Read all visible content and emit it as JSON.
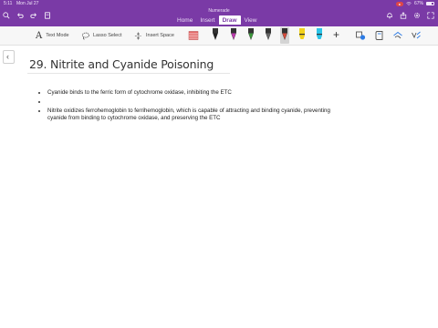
{
  "status_bar": {
    "time": "5:11",
    "date": "Mon Jul 27",
    "battery_text": "67%",
    "battery_level": 0.67,
    "recording_color": "#e04747"
  },
  "app": {
    "title": "Numerade",
    "brand_color": "#7a3aa6"
  },
  "tabs": [
    {
      "label": "Home",
      "active": false
    },
    {
      "label": "Insert",
      "active": false
    },
    {
      "label": "Draw",
      "active": true
    },
    {
      "label": "View",
      "active": false
    }
  ],
  "toolbar": {
    "text_mode_label": "Text Mode",
    "lasso_label": "Lasso Select",
    "insert_space_label": "Insert Space",
    "pens": [
      {
        "icon": "pen-icon",
        "color": "#222222"
      },
      {
        "icon": "pen-icon",
        "color": "#c03ab0"
      },
      {
        "icon": "pen-icon",
        "color": "#3a9a3a"
      },
      {
        "icon": "pen-icon",
        "color": "#666666"
      },
      {
        "icon": "pen-icon",
        "color": "#d94a3a"
      },
      {
        "icon": "pen-icon",
        "color": "#444444"
      },
      {
        "icon": "highlighter-icon",
        "color": "#f2d21b"
      },
      {
        "icon": "highlighter-icon",
        "color": "#2bc4e8"
      }
    ]
  },
  "note": {
    "title": "29. Nitrite and Cyanide Poisoning",
    "bullets": [
      "Cyanide binds to the ferric form of cytochrome oxidase, inhibiting the ETC",
      "",
      "Nitrite oxidizes ferrohemoglobin to ferrihemoglobin, which is capable of attracting and binding cyanide, preventing cyanide from binding to cytochrome oxidase, and preserving the ETC"
    ]
  }
}
